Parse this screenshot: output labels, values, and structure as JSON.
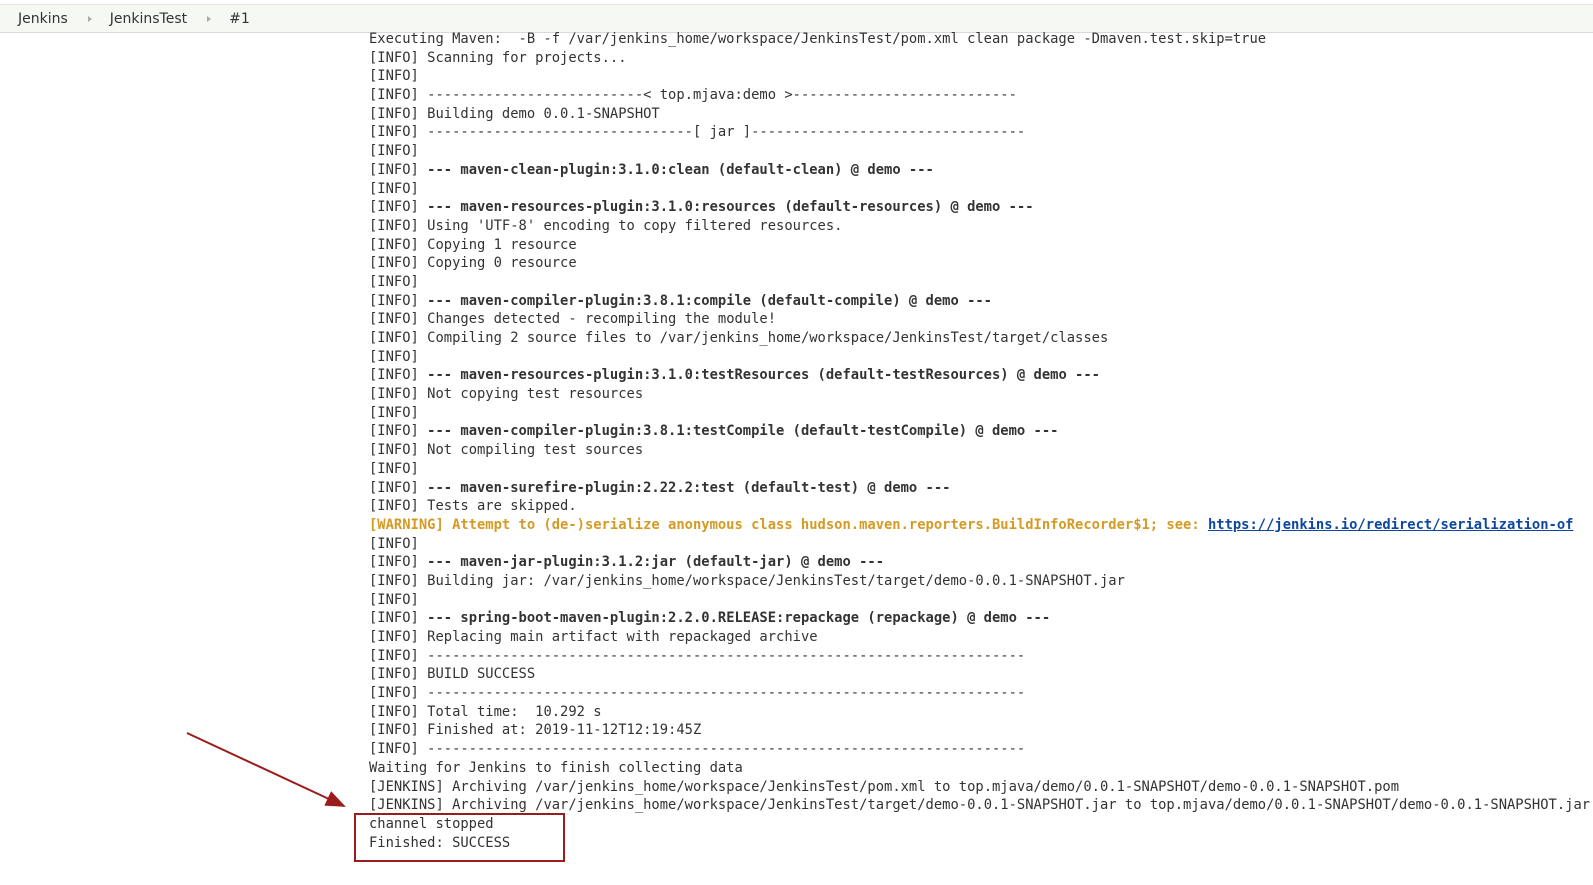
{
  "breadcrumb": [
    "Jenkins",
    "JenkinsTest",
    "#1"
  ],
  "console": [
    {
      "p": "",
      "t": "Executing Maven:  -B -f /var/jenkins_home/workspace/JenkinsTest/pom.xml clean package -Dmaven.test.skip=true"
    },
    {
      "p": "[INFO] ",
      "t": "Scanning for projects..."
    },
    {
      "p": "[INFO]",
      "t": ""
    },
    {
      "p": "[INFO] ",
      "t": "--------------------------< top.mjava:demo >---------------------------"
    },
    {
      "p": "[INFO] ",
      "t": "Building demo 0.0.1-SNAPSHOT"
    },
    {
      "p": "[INFO] ",
      "t": "--------------------------------[ jar ]---------------------------------"
    },
    {
      "p": "[INFO]",
      "t": ""
    },
    {
      "p": "[INFO] ",
      "t": "--- maven-clean-plugin:3.1.0:clean (default-clean) @ demo ---",
      "bold": true
    },
    {
      "p": "[INFO]",
      "t": ""
    },
    {
      "p": "[INFO] ",
      "t": "--- maven-resources-plugin:3.1.0:resources (default-resources) @ demo ---",
      "bold": true
    },
    {
      "p": "[INFO] ",
      "t": "Using 'UTF-8' encoding to copy filtered resources."
    },
    {
      "p": "[INFO] ",
      "t": "Copying 1 resource"
    },
    {
      "p": "[INFO] ",
      "t": "Copying 0 resource"
    },
    {
      "p": "[INFO]",
      "t": ""
    },
    {
      "p": "[INFO] ",
      "t": "--- maven-compiler-plugin:3.8.1:compile (default-compile) @ demo ---",
      "bold": true
    },
    {
      "p": "[INFO] ",
      "t": "Changes detected - recompiling the module!"
    },
    {
      "p": "[INFO] ",
      "t": "Compiling 2 source files to /var/jenkins_home/workspace/JenkinsTest/target/classes"
    },
    {
      "p": "[INFO]",
      "t": ""
    },
    {
      "p": "[INFO] ",
      "t": "--- maven-resources-plugin:3.1.0:testResources (default-testResources) @ demo ---",
      "bold": true
    },
    {
      "p": "[INFO] ",
      "t": "Not copying test resources"
    },
    {
      "p": "[INFO]",
      "t": ""
    },
    {
      "p": "[INFO] ",
      "t": "--- maven-compiler-plugin:3.8.1:testCompile (default-testCompile) @ demo ---",
      "bold": true
    },
    {
      "p": "[INFO] ",
      "t": "Not compiling test sources"
    },
    {
      "p": "[INFO]",
      "t": ""
    },
    {
      "p": "[INFO] ",
      "t": "--- maven-surefire-plugin:2.22.2:test (default-test) @ demo ---",
      "bold": true
    },
    {
      "p": "[INFO] ",
      "t": "Tests are skipped."
    },
    {
      "p": "",
      "t": "[WARNING] Attempt to (de-)serialize anonymous class hudson.maven.reporters.BuildInfoRecorder$1; see: ",
      "warn": true,
      "link": "https://jenkins.io/redirect/serialization-of"
    },
    {
      "p": "[INFO]",
      "t": ""
    },
    {
      "p": "[INFO] ",
      "t": "--- maven-jar-plugin:3.1.2:jar (default-jar) @ demo ---",
      "bold": true
    },
    {
      "p": "[INFO] ",
      "t": "Building jar: /var/jenkins_home/workspace/JenkinsTest/target/demo-0.0.1-SNAPSHOT.jar"
    },
    {
      "p": "[INFO]",
      "t": ""
    },
    {
      "p": "[INFO] ",
      "t": "--- spring-boot-maven-plugin:2.2.0.RELEASE:repackage (repackage) @ demo ---",
      "bold": true
    },
    {
      "p": "[INFO] ",
      "t": "Replacing main artifact with repackaged archive"
    },
    {
      "p": "[INFO] ",
      "t": "------------------------------------------------------------------------"
    },
    {
      "p": "[INFO] ",
      "t": "BUILD SUCCESS"
    },
    {
      "p": "[INFO] ",
      "t": "------------------------------------------------------------------------"
    },
    {
      "p": "[INFO] ",
      "t": "Total time:  10.292 s"
    },
    {
      "p": "[INFO] ",
      "t": "Finished at: 2019-11-12T12:19:45Z"
    },
    {
      "p": "[INFO] ",
      "t": "------------------------------------------------------------------------"
    },
    {
      "p": "",
      "t": "Waiting for Jenkins to finish collecting data"
    },
    {
      "p": "[JENKINS] ",
      "t": "Archiving /var/jenkins_home/workspace/JenkinsTest/pom.xml to top.mjava/demo/0.0.1-SNAPSHOT/demo-0.0.1-SNAPSHOT.pom"
    },
    {
      "p": "[JENKINS] ",
      "t": "Archiving /var/jenkins_home/workspace/JenkinsTest/target/demo-0.0.1-SNAPSHOT.jar to top.mjava/demo/0.0.1-SNAPSHOT/demo-0.0.1-SNAPSHOT.jar"
    },
    {
      "p": "",
      "t": "channel stopped"
    },
    {
      "p": "",
      "t": "Finished: SUCCESS"
    }
  ],
  "colors": {
    "warning": "#d49a24",
    "link": "#0d47a1",
    "annotation": "#9b1c1c"
  }
}
